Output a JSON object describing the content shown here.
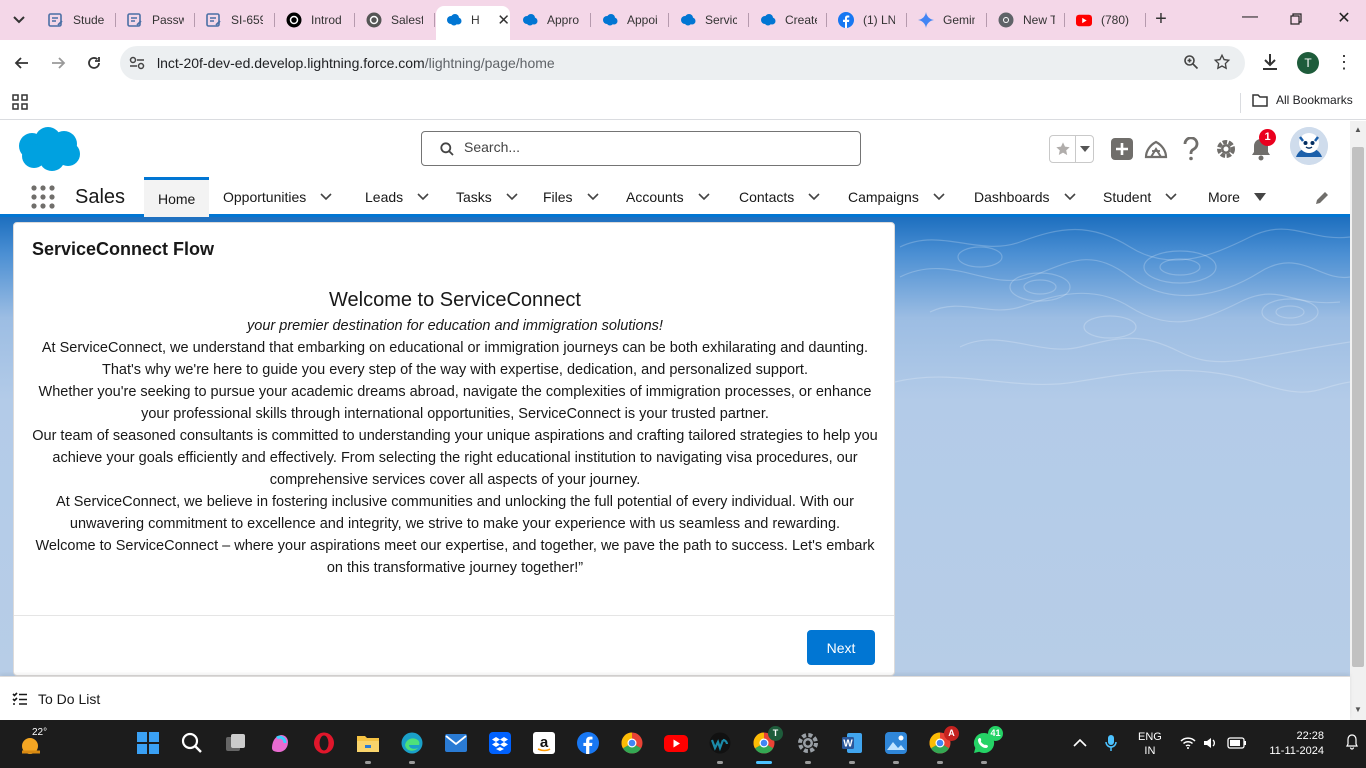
{
  "browser": {
    "tabs": [
      {
        "title": "Studen",
        "icon": "form-icon",
        "color": "#4a6fa5"
      },
      {
        "title": "Passw",
        "icon": "form-icon",
        "color": "#4a6fa5"
      },
      {
        "title": "SI-659",
        "icon": "form-icon",
        "color": "#4a6fa5"
      },
      {
        "title": "Introd",
        "icon": "chatgpt-icon",
        "color": "#000000"
      },
      {
        "title": "Salesf",
        "icon": "chatgpt-icon",
        "color": "#555555"
      },
      {
        "title": "H",
        "icon": "salesforce-cloud-icon",
        "color": "#0176d3",
        "active": true
      },
      {
        "title": "Appro",
        "icon": "salesforce-cloud-icon",
        "color": "#0176d3"
      },
      {
        "title": "Appoi",
        "icon": "salesforce-cloud-icon",
        "color": "#0176d3"
      },
      {
        "title": "Servic",
        "icon": "salesforce-cloud-icon",
        "color": "#0176d3"
      },
      {
        "title": "Create",
        "icon": "salesforce-cloud-icon",
        "color": "#0176d3"
      },
      {
        "title": "(1) LN",
        "icon": "facebook-icon",
        "color": "#1877f2"
      },
      {
        "title": "Gemin",
        "icon": "gemini-icon",
        "color": "#4285f4"
      },
      {
        "title": "New T",
        "icon": "chrome-icon",
        "color": "#5f6368"
      },
      {
        "title": "(780)",
        "icon": "youtube-icon",
        "color": "#ff0000"
      }
    ],
    "url_host": "lnct-20f-dev-ed.develop.lightning.force.com",
    "url_path": "/lightning/page/home",
    "profile_initial": "T",
    "all_bookmarks": "All Bookmarks"
  },
  "salesforce": {
    "search_placeholder": "Search...",
    "notification_count": "1",
    "app_name": "Sales",
    "nav": [
      {
        "label": "Home",
        "active": true
      },
      {
        "label": "Opportunities"
      },
      {
        "label": "Leads"
      },
      {
        "label": "Tasks"
      },
      {
        "label": "Files"
      },
      {
        "label": "Accounts"
      },
      {
        "label": "Contacts"
      },
      {
        "label": "Campaigns"
      },
      {
        "label": "Dashboards"
      },
      {
        "label": "Student"
      },
      {
        "label": "More"
      }
    ],
    "brand_color": "#0176d3"
  },
  "card": {
    "title": "ServiceConnect Flow",
    "welcome": "Welcome to ServiceConnect",
    "tagline": "your premier destination for education and immigration solutions!",
    "paragraphs": [
      "At ServiceConnect, we understand that embarking on educational or immigration journeys can be both exhilarating and daunting. That's why we're here to guide you every step of the way with expertise, dedication, and personalized support.",
      "Whether you're seeking to pursue your academic dreams abroad, navigate the complexities of immigration processes, or enhance your professional skills through international opportunities, ServiceConnect is your trusted partner.",
      "Our team of seasoned consultants is committed to understanding your unique aspirations and crafting tailored strategies to help you achieve your goals efficiently and effectively. From selecting the right educational institution to navigating visa procedures, our comprehensive services cover all aspects of your journey.",
      "At ServiceConnect, we believe in fostering inclusive communities and unlocking the full potential of every individual. With our unwavering commitment to excellence and integrity, we strive to make your experience with us seamless and rewarding.",
      "Welcome to ServiceConnect – where your aspirations meet our expertise, and together, we pave the path to success. Let's embark on this transformative journey together!”"
    ],
    "next_label": "Next"
  },
  "utility_bar": {
    "todo_label": "To Do List"
  },
  "taskbar": {
    "temperature": "22°",
    "apps": [
      {
        "name": "windows-start-icon",
        "color": "#3aa0f3"
      },
      {
        "name": "search-icon",
        "color": "#ffffff"
      },
      {
        "name": "task-view-icon",
        "color": "#cccccc"
      },
      {
        "name": "copilot-icon",
        "color": "#e86bd0"
      },
      {
        "name": "opera-icon",
        "color": "#e0162b"
      },
      {
        "name": "file-explorer-icon",
        "color": "#f6c343"
      },
      {
        "name": "edge-icon",
        "color": "#1aa0c8"
      },
      {
        "name": "mail-icon",
        "color": "#2a7bd4"
      },
      {
        "name": "dropbox-icon",
        "color": "#0061fe"
      },
      {
        "name": "amazon-icon",
        "color": "#ffffff"
      },
      {
        "name": "facebook-icon",
        "color": "#1877f2"
      },
      {
        "name": "chrome-icon",
        "color": "#34a853"
      },
      {
        "name": "youtube-icon",
        "color": "#ff0000"
      },
      {
        "name": "webex-icon",
        "color": "#1b8aa8"
      },
      {
        "name": "chrome-profile-icon",
        "color": "#34a853",
        "active": true
      },
      {
        "name": "settings-icon",
        "color": "#9aa0a6"
      },
      {
        "name": "word-icon",
        "color": "#2b579a"
      },
      {
        "name": "photos-icon",
        "color": "#2f86d8"
      },
      {
        "name": "chrome-alt-icon",
        "color": "#ea4335"
      },
      {
        "name": "whatsapp-icon",
        "color": "#25d366"
      }
    ],
    "whatsapp_badge": "41",
    "chrome_alt_badge": "A",
    "chrome_profile_badge": "T",
    "language_line1": "ENG",
    "language_line2": "IN",
    "time": "22:28",
    "date": "11-11-2024"
  }
}
